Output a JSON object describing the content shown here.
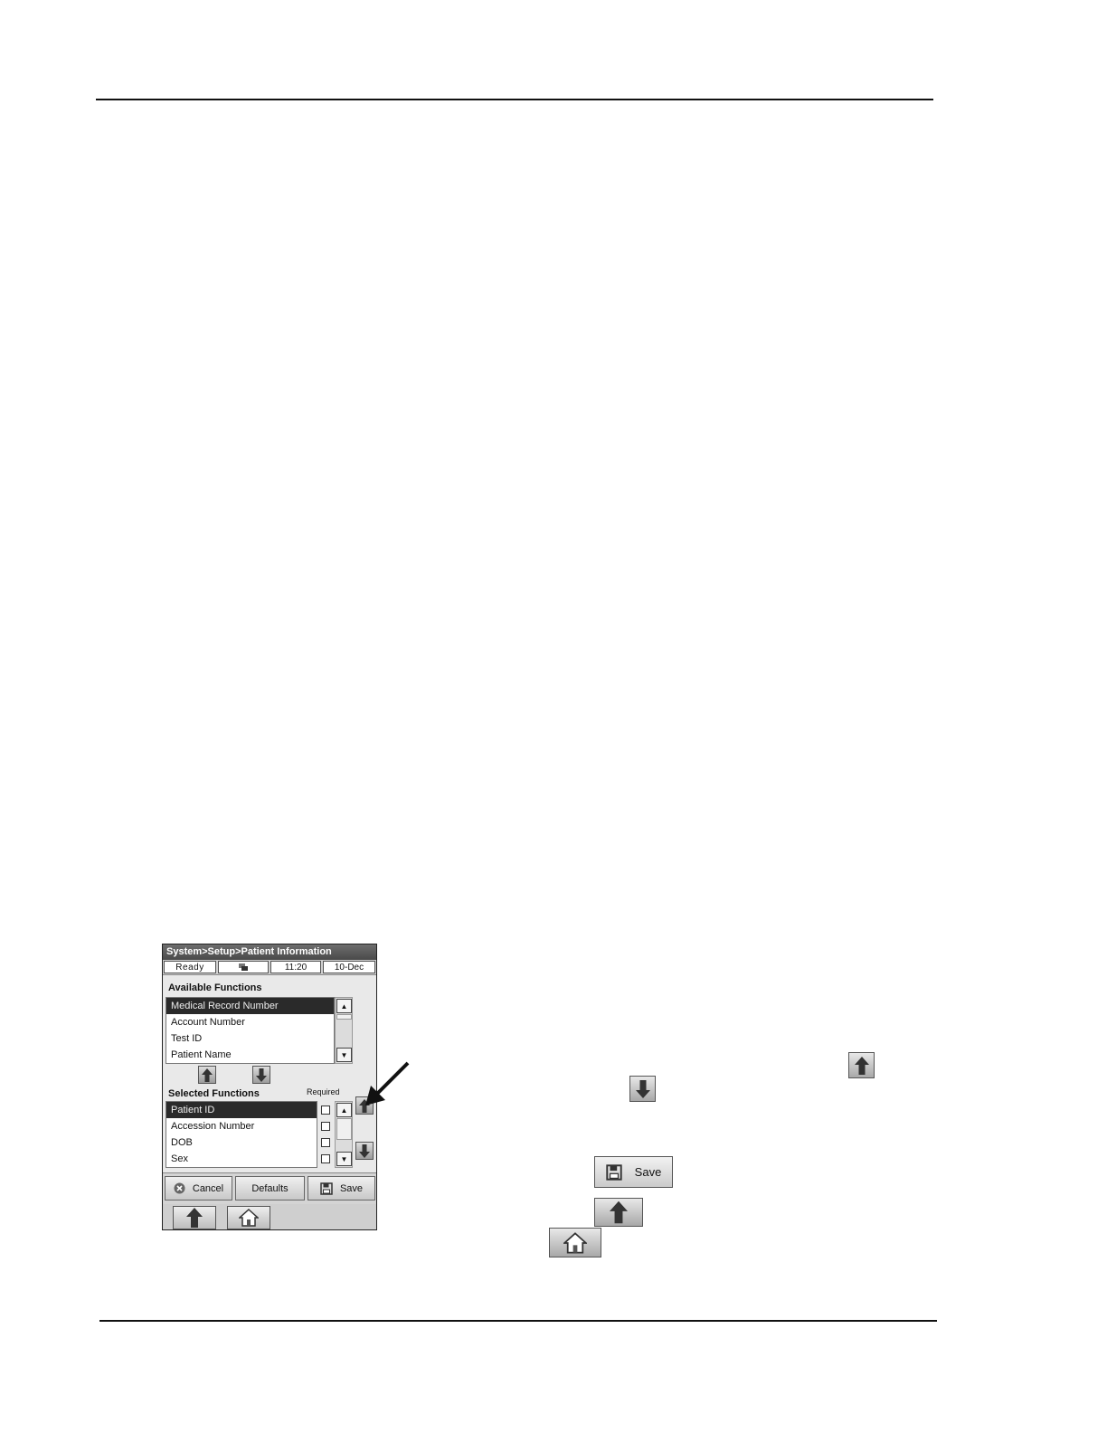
{
  "screen": {
    "title": "System>Setup>Patient Information",
    "status": {
      "state": "Ready",
      "time": "11:20",
      "date": "10-Dec"
    },
    "available": {
      "label": "Available Functions",
      "items": [
        "Medical Record Number",
        "Account Number",
        "Test ID",
        "Patient Name"
      ]
    },
    "selected": {
      "label": "Selected Functions",
      "required_label": "Required",
      "items": [
        "Patient ID",
        "Accession Number",
        "DOB",
        "Sex"
      ]
    },
    "buttons": {
      "cancel": "Cancel",
      "defaults": "Defaults",
      "save": "Save"
    }
  },
  "inline_save_label": "Save",
  "icons": [
    "network-icon",
    "up-arrow-icon",
    "down-arrow-icon",
    "cancel-x-icon",
    "floppy-disk-icon",
    "home-icon"
  ]
}
